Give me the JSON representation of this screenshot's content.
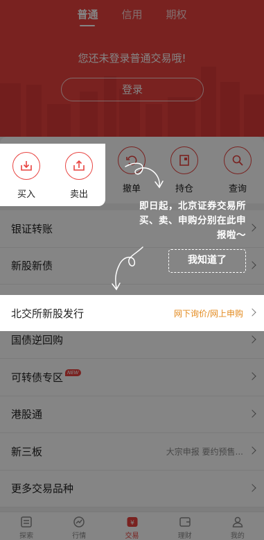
{
  "header": {
    "tabs": [
      {
        "label": "普通",
        "active": true
      },
      {
        "label": "信用",
        "active": false
      },
      {
        "label": "期权",
        "active": false
      }
    ],
    "login_prompt": "您还未登录普通交易哦!",
    "login_button": "登录"
  },
  "quick_actions": [
    {
      "label": "买入",
      "icon": "buy-icon"
    },
    {
      "label": "卖出",
      "icon": "sell-icon"
    },
    {
      "label": "撤单",
      "icon": "cancel-order-icon"
    },
    {
      "label": "持仓",
      "icon": "holdings-icon"
    },
    {
      "label": "查询",
      "icon": "search-icon"
    }
  ],
  "menu": [
    {
      "label": "银证转账",
      "right": ""
    },
    {
      "label": "新股新债",
      "right": ""
    },
    {
      "label": "北交所新股发行",
      "right": "网下询价/网上申购",
      "highlight": true
    },
    {
      "label": "国债逆回购",
      "right": ""
    },
    {
      "label": "可转债专区",
      "right": "",
      "badge": "NEW"
    },
    {
      "label": "港股通",
      "right": ""
    },
    {
      "label": "新三板",
      "right": "大宗申报 要约预售..."
    },
    {
      "label": "更多交易品种",
      "right": ""
    }
  ],
  "guide": {
    "tip_lines": [
      "即日起，北京证券交易所",
      "买、卖、申购分别在此申",
      "报啦～"
    ],
    "got_it": "我知道了"
  },
  "tabbar": [
    {
      "label": "探索",
      "icon": "explore-icon",
      "active": false
    },
    {
      "label": "行情",
      "icon": "market-icon",
      "active": false
    },
    {
      "label": "交易",
      "icon": "trade-icon",
      "active": true
    },
    {
      "label": "理财",
      "icon": "wallet-icon",
      "active": false
    },
    {
      "label": "我的",
      "icon": "profile-icon",
      "active": false
    }
  ],
  "colors": {
    "brand": "#e8423f",
    "highlight": "#e38a1e"
  }
}
